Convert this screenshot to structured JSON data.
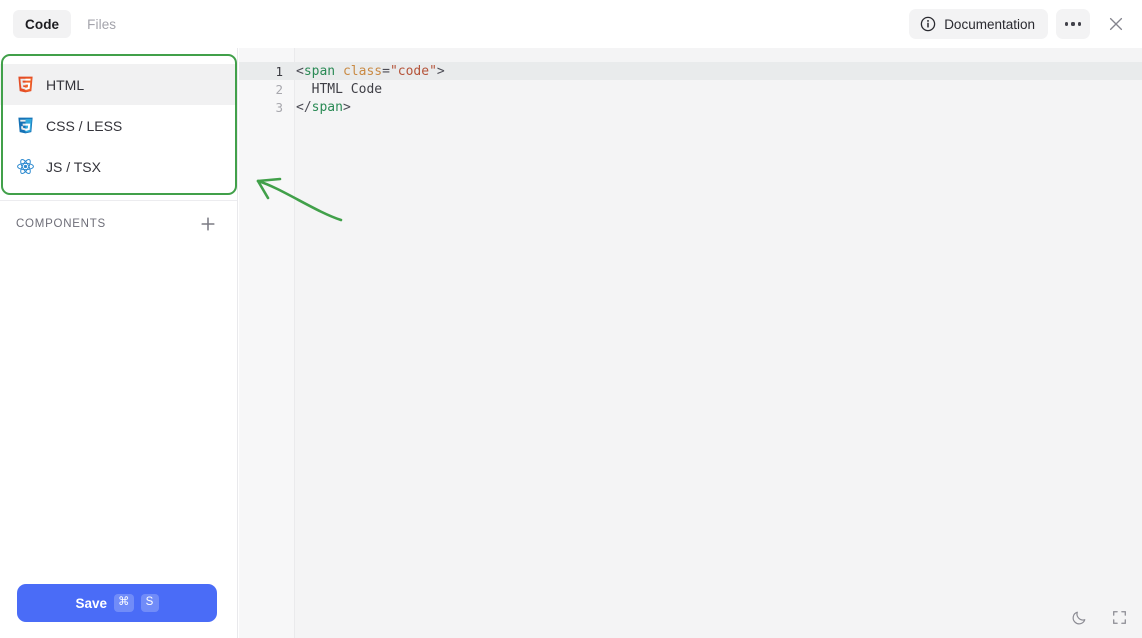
{
  "window": {
    "tabs": [
      {
        "label": "Code",
        "active": true
      },
      {
        "label": "Files",
        "active": false
      }
    ],
    "documentation_label": "Documentation",
    "more_label": "",
    "close_label": ""
  },
  "sidebar": {
    "files": [
      {
        "label": "HTML",
        "icon": "html5-icon",
        "selected": true
      },
      {
        "label": "CSS / LESS",
        "icon": "css3-icon",
        "selected": false
      },
      {
        "label": "JS / TSX",
        "icon": "react-icon",
        "selected": false
      }
    ],
    "components": {
      "title": "COMPONENTS",
      "add_label": "+"
    },
    "save": {
      "label": "Save",
      "shortcut_modifier": "⌘",
      "shortcut_key": "S"
    }
  },
  "editor": {
    "language": "html",
    "active_line": 1,
    "lines": [
      {
        "number": "1",
        "tokens": [
          {
            "text": "<",
            "type": "punct"
          },
          {
            "text": "span",
            "type": "tag"
          },
          {
            "text": " ",
            "type": "text"
          },
          {
            "text": "class",
            "type": "attr"
          },
          {
            "text": "=",
            "type": "punct"
          },
          {
            "text": "\"code\"",
            "type": "str"
          },
          {
            "text": ">",
            "type": "punct"
          }
        ]
      },
      {
        "number": "2",
        "tokens": [
          {
            "text": "  HTML Code",
            "type": "text"
          }
        ]
      },
      {
        "number": "3",
        "tokens": [
          {
            "text": "</",
            "type": "punct"
          },
          {
            "text": "span",
            "type": "tag"
          },
          {
            "text": ">",
            "type": "punct"
          }
        ]
      }
    ],
    "footer": {
      "dark_mode_label": "",
      "fullscreen_label": ""
    }
  },
  "annotation": {
    "highlight_color": "#41a04a",
    "target": "file-type-list"
  },
  "colors": {
    "accent": "#4a6cf7",
    "annotation_green": "#41a04a",
    "html5": "#e44d26",
    "css3": "#1572b6",
    "react": "#2e8bd0",
    "editor_bg": "#f4f4f5",
    "active_line": "#e9ebec"
  }
}
